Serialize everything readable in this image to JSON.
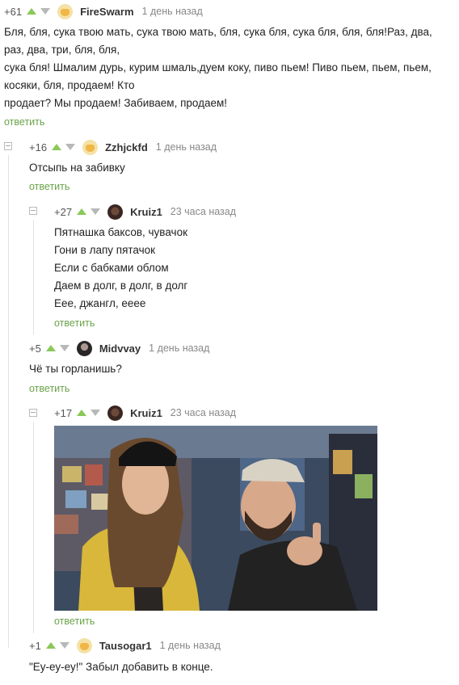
{
  "comments": [
    {
      "rating": "+61",
      "user": "FireSwarm",
      "time": "1 день назад",
      "lines": [
        "Бля, бля, сука твою мать, сука твою мать, бля, сука бля, сука бля, бля, бля!Раз, два,",
        "раз, два, три, бля, бля,",
        "сука бля! Шмалим дурь, курим шмаль,дуем коку, пиво пьем! Пиво пьем, пьем, пьем,",
        "косяки, бля, продаем! Кто",
        "продает? Мы продаем! Забиваем, продаем!"
      ],
      "reply": "ответить"
    },
    {
      "rating": "+16",
      "user": "Zzhjckfd",
      "time": "1 день назад",
      "lines": [
        "Отсыпь на забивку"
      ],
      "reply": "ответить"
    },
    {
      "rating": "+27",
      "user": "Kruiz1",
      "time": "23 часа назад",
      "lines": [
        "Пятнашка баксов, чувачок",
        "Гони в лапу пятачок",
        "Если с бабками облом",
        "Даем в долг, в долг, в долг",
        "Еее, джангл, ееее"
      ],
      "reply": "ответить"
    },
    {
      "rating": "+5",
      "user": "Midvvay",
      "time": "1 день назад",
      "lines": [
        "Чё ты горланишь?"
      ],
      "reply": "ответить"
    },
    {
      "rating": "+17",
      "user": "Kruiz1",
      "time": "23 часа назад",
      "lines": [],
      "reply": "ответить"
    },
    {
      "rating": "+1",
      "user": "Tausogar1",
      "time": "1 день назад",
      "lines": [
        "\"Еу-еу-еу!\"  Забыл добавить в конце."
      ],
      "reply": ""
    }
  ]
}
